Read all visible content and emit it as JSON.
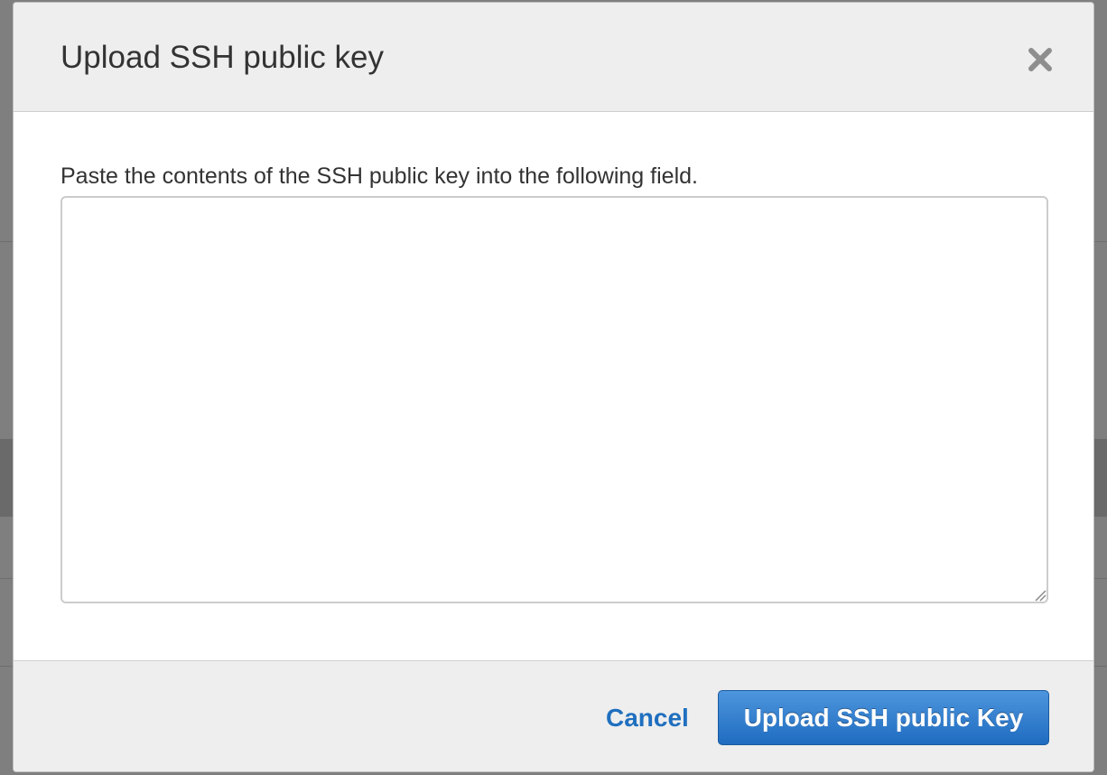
{
  "dialog": {
    "title": "Upload SSH public key",
    "instructions": "Paste the contents of the SSH public key into the following field.",
    "textarea": {
      "value": "",
      "placeholder": ""
    },
    "footer": {
      "cancel_label": "Cancel",
      "submit_label": "Upload SSH public Key"
    }
  },
  "icons": {
    "close": "close-icon",
    "resize": "resize-handle-icon"
  },
  "colors": {
    "accent": "#1f6fbf",
    "button_top": "#4d95dd",
    "button_bottom": "#1f6cc0",
    "header_bg": "#eeeeee",
    "text": "#333333"
  }
}
